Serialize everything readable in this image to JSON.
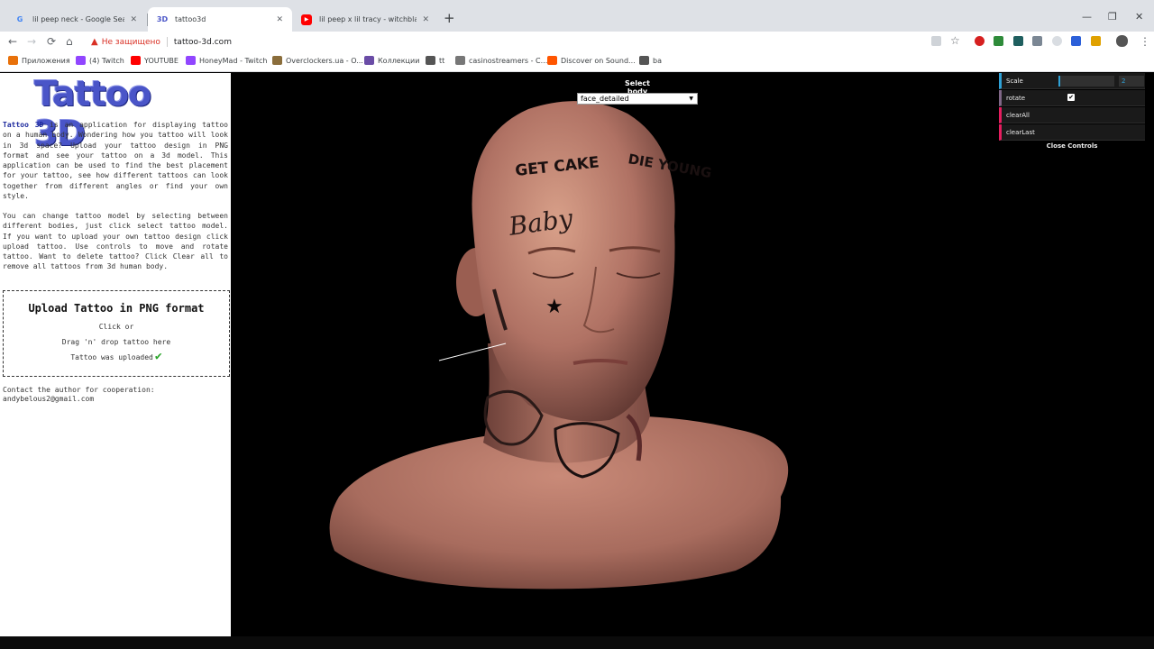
{
  "tabs": [
    {
      "title": "lil peep neck - Google Search",
      "icon": "google-icon"
    },
    {
      "title": "tattoo3d",
      "icon": "tattoo3d-favicon-icon"
    },
    {
      "title": "lil peep x lil tracy - witchblades (a",
      "icon": "youtube-icon"
    }
  ],
  "tab_favicons": [
    "G",
    "3D",
    "▶"
  ],
  "new_tab": "+",
  "window_controls": [
    "—",
    "❐",
    "✕"
  ],
  "nav": {
    "back": "←",
    "forward": "→",
    "reload": "⟳",
    "home": "⌂",
    "star": "☆",
    "menu": "⋮"
  },
  "address": {
    "warn_icon": "▲",
    "security_text": "Не защищено",
    "url": "tattoo-3d.com"
  },
  "bookmarks": [
    {
      "label": "Приложения",
      "icon": "apps-grid-icon",
      "color": "#e8710a"
    },
    {
      "label": "(4) Twitch",
      "icon": "twitch-icon",
      "color": "#9146ff"
    },
    {
      "label": "YOUTUBE",
      "icon": "youtube-icon",
      "color": "#ff0000"
    },
    {
      "label": "HoneyMad - Twitch",
      "icon": "twitch-icon",
      "color": "#9146ff"
    },
    {
      "label": "Overclockers.ua - O...",
      "icon": "overclockers-icon",
      "color": "#8a6d3b"
    },
    {
      "label": "Коллекции",
      "icon": "collections-icon",
      "color": "#6a4ca6"
    },
    {
      "label": "tt",
      "icon": "globe-icon",
      "color": "#555555"
    },
    {
      "label": "casinostreamers - C...",
      "icon": "casino-icon",
      "color": "#777777"
    },
    {
      "label": "Discover on Sound...",
      "icon": "soundcloud-icon",
      "color": "#ff5500"
    },
    {
      "label": "ba",
      "icon": "globe-icon",
      "color": "#555555"
    }
  ],
  "sidebar": {
    "logo": "Tattoo 3D",
    "p1_brand": "Tattoo 3D",
    "p1_text": " is an application for displaying tattoo on a human body. Wondering how you tattoo will look in 3d space? Upload your tattoo design in PNG format and see your tattoo on a 3d model. This application can be used to find the best placement for your tattoo, see how different tattoos can look together from different angles or find your own style.",
    "p2_text": "You can change tattoo model by selecting between different bodies, just click select tattoo model. If you want to upload your own tattoo design click upload tattoo. Use controls to move and rotate tattoo. Want to delete tattoo? Click Clear all to remove all tattoos from 3d human body.",
    "upload_title": "Upload Tattoo in PNG format",
    "upload_click": "Click or",
    "upload_drag": "Drag 'n' drop tattoo here",
    "upload_status": "Tattoo was uploaded",
    "check_glyph": "✔",
    "contact_label": "Contact the author for cooperation:",
    "contact_email": "andybelous2@gmail.com"
  },
  "viewer": {
    "select_label": "Select body",
    "select_value": "face_detailed",
    "select_arrow": "▼",
    "tattoo_forehead_left": "GET CAKE",
    "tattoo_forehead_right": "DIE YOUNG",
    "tattoo_temple": "Baby",
    "tattoo_star_glyph": "★"
  },
  "gui": {
    "scale_label": "Scale",
    "scale_value": "2",
    "scale_fraction": 0.03,
    "rotate_label": "rotate",
    "rotate_checked": "✔",
    "clear_all_label": "clearAll",
    "clear_last_label": "clearLast",
    "close_label": "Close Controls"
  },
  "colors": {
    "accent": "#2fa1d6",
    "brand": "#4a55c8",
    "warning": "#d93025",
    "success": "#2aa52a"
  }
}
